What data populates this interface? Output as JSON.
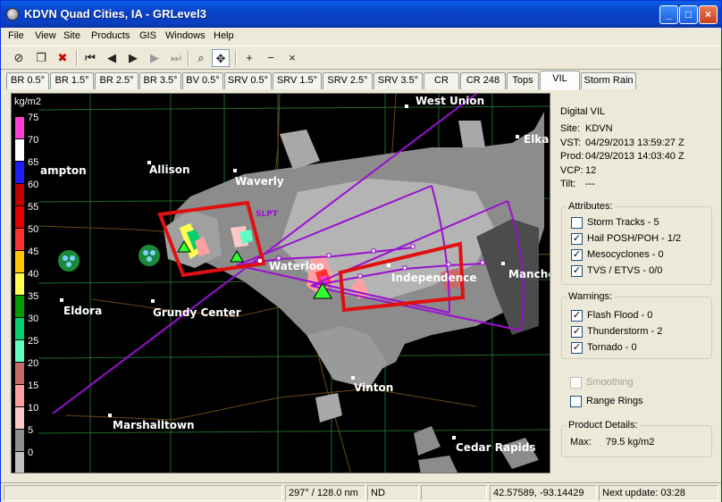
{
  "window": {
    "title": "KDVN Quad Cities, IA - GRLevel3",
    "minimize": "_",
    "maximize": "□",
    "close": "×"
  },
  "menu": [
    "File",
    "View",
    "Site",
    "Products",
    "GIS",
    "Windows",
    "Help"
  ],
  "toolbar": [
    {
      "icon": "clear-icon",
      "glyph": "⊘",
      "dim": true
    },
    {
      "icon": "copy-icon",
      "glyph": "❐",
      "dim": false
    },
    {
      "icon": "stop-icon",
      "glyph": "✖",
      "dim": false
    },
    {
      "icon": "skip-first-icon",
      "glyph": "⏮",
      "dim": false
    },
    {
      "icon": "step-back-icon",
      "glyph": "◀",
      "dim": false
    },
    {
      "icon": "play-icon",
      "glyph": "▶",
      "dim": false
    },
    {
      "icon": "step-forward-icon",
      "glyph": "▶",
      "dim": true
    },
    {
      "icon": "skip-last-icon",
      "glyph": "⏭",
      "dim": true
    },
    {
      "icon": "zoom-icon",
      "glyph": "⌕",
      "dim": false
    },
    {
      "icon": "pan-icon",
      "glyph": "✥",
      "dim": false
    },
    {
      "icon": "zoom-in-icon",
      "glyph": "+",
      "dim": false
    },
    {
      "icon": "zoom-out-icon",
      "glyph": "−",
      "dim": false
    },
    {
      "icon": "zoom-reset-icon",
      "glyph": "×",
      "dim": false
    }
  ],
  "tabs": [
    "BR 0.5°",
    "BR 1.5°",
    "BR 2.5°",
    "BR 3.5°",
    "BV 0.5°",
    "SRV 0.5°",
    "SRV 1.5°",
    "SRV 2.5°",
    "SRV 3.5°",
    "CR",
    "CR 248",
    "Tops",
    "VIL",
    "Storm Rain"
  ],
  "active_tab": "VIL",
  "legend": {
    "unit": "kg/m2",
    "levels": [
      {
        "label": "75",
        "color": "#ff3fd4"
      },
      {
        "label": "70",
        "color": "#ffffff"
      },
      {
        "label": "65",
        "color": "#1e1eff"
      },
      {
        "label": "60",
        "color": "#c40000"
      },
      {
        "label": "55",
        "color": "#e80000"
      },
      {
        "label": "50",
        "color": "#ff3030"
      },
      {
        "label": "45",
        "color": "#ffc800"
      },
      {
        "label": "40",
        "color": "#ffff50"
      },
      {
        "label": "35",
        "color": "#00a000"
      },
      {
        "label": "30",
        "color": "#00d070"
      },
      {
        "label": "25",
        "color": "#60ffc0"
      },
      {
        "label": "20",
        "color": "#c86a6a"
      },
      {
        "label": "15",
        "color": "#ffa0a0"
      },
      {
        "label": "10",
        "color": "#ffc8c8"
      },
      {
        "label": "5",
        "color": "#909090"
      },
      {
        "label": "0",
        "color": "#c0c0c0"
      }
    ]
  },
  "map": {
    "cities": [
      "West Union",
      "Elkad",
      "ampton",
      "Allison",
      "Waverly",
      "SLPT",
      "Waterloo",
      "Independence",
      "Manches",
      "Eldora",
      "Grundy Center",
      "Vinton",
      "Marshalltown",
      "Cedar Rapids"
    ]
  },
  "panel": {
    "product": "Digital VIL",
    "site": {
      "label": "Site:",
      "value": "KDVN"
    },
    "vst": {
      "label": "VST:",
      "value": "04/29/2013  13:59:27 Z"
    },
    "prod": {
      "label": "Prod:",
      "value": "04/29/2013  14:03:40 Z"
    },
    "vcp": {
      "label": "VCP:",
      "value": "12"
    },
    "tilt": {
      "label": "Tilt:",
      "value": "---"
    },
    "attributes_title": "Attributes:",
    "attributes": [
      {
        "label": "Storm Tracks - 5",
        "checked": false
      },
      {
        "label": "Hail POSH/POH - 1/2",
        "checked": true
      },
      {
        "label": "Mesocyclones - 0",
        "checked": true
      },
      {
        "label": "TVS / ETVS - 0/0",
        "checked": true
      }
    ],
    "warnings_title": "Warnings:",
    "warnings": [
      {
        "label": "Flash Flood - 0",
        "checked": true
      },
      {
        "label": "Thunderstorm - 2",
        "checked": true
      },
      {
        "label": "Tornado - 0",
        "checked": true
      }
    ],
    "smoothing": {
      "label": "Smoothing",
      "checked": false,
      "disabled": true
    },
    "range_rings": {
      "label": "Range Rings",
      "checked": false
    },
    "details_title": "Product Details:",
    "max_label": "Max:",
    "max_value": "79.5 kg/m2"
  },
  "status": {
    "pane1": "",
    "azimuth_range": "297° / 128.0 nm",
    "value": "ND",
    "pane4": "",
    "latlon": "42.57589, -93.14429",
    "next_update": "Next update: 03:28"
  }
}
